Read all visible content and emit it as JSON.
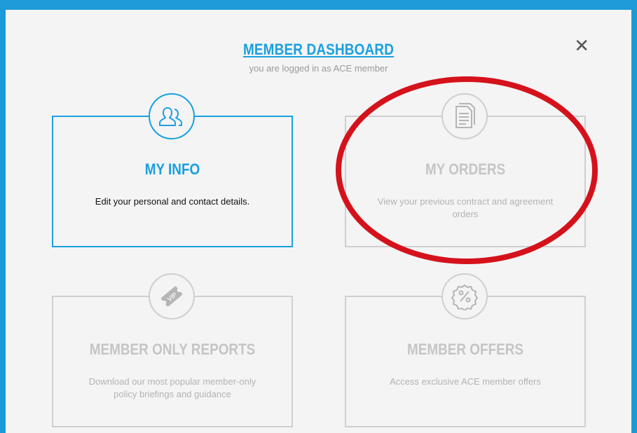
{
  "header": {
    "title": "MEMBER DASHBOARD",
    "subtitle": "you are logged in as ACE member",
    "close_label": "✕"
  },
  "cards": [
    {
      "title": "MY INFO",
      "description": "Edit your personal and contact details.",
      "icon": "users-icon"
    },
    {
      "title": "MY ORDERS",
      "description": "View your previous contract and agreement orders",
      "icon": "document-icon"
    },
    {
      "title": "MEMBER ONLY REPORTS",
      "description": "Download our most popular member-only policy briefings and guidance",
      "icon": "vip-ticket-icon"
    },
    {
      "title": "MEMBER OFFERS",
      "description": "Access exclusive ACE member offers",
      "icon": "percent-badge-icon"
    }
  ],
  "colors": {
    "accent": "#1aa0e0",
    "inactive": "#cfcfcf",
    "highlight": "#d5121b"
  }
}
